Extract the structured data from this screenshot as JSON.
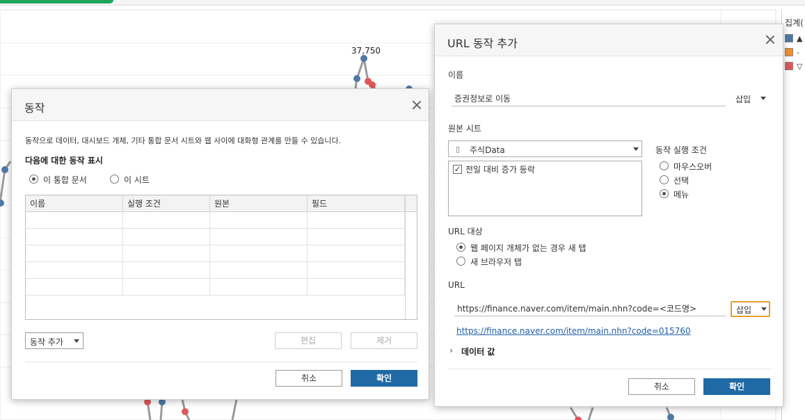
{
  "chart_data": {
    "type": "line",
    "title": "",
    "annotations": [
      "37,750"
    ],
    "series": []
  },
  "legend": {
    "title": "집계(",
    "items": [
      {
        "symbol": "▲",
        "color": "#4e79a7"
      },
      {
        "symbol": "-",
        "color": "#f28e2b"
      },
      {
        "symbol": "▽",
        "color": "#e15759"
      }
    ]
  },
  "actions_dialog": {
    "title": "동작",
    "description": "동작으로 데이터, 대시보드 개체, 기타 통합 문서 시트와 웹 사이에 대화형 관계를 만들 수 있습니다.",
    "show_actions_for": "다음에 대한 동작 표시",
    "scope_options": [
      {
        "label": "이 통합 문서",
        "selected": true
      },
      {
        "label": "이 시트",
        "selected": false
      }
    ],
    "table_columns": [
      "이름",
      "실행 조건",
      "원본",
      "필드"
    ],
    "add_action": "동작 추가",
    "edit": "편집",
    "remove": "제거",
    "cancel": "취소",
    "ok": "확인"
  },
  "url_dialog": {
    "title": "URL 동작 추가",
    "name_label": "이름",
    "name_value": "증권정보로 이동",
    "insert_label": "삽입",
    "source_sheet_label": "원본 시트",
    "source_value": "주식Data",
    "sheets": [
      {
        "label": "전일 대비 증가 등락",
        "checked": true
      }
    ],
    "run_on_label": "동작 실행 조건",
    "run_on_options": [
      {
        "label": "마우스오버",
        "selected": false
      },
      {
        "label": "선택",
        "selected": false
      },
      {
        "label": "메뉴",
        "selected": true
      }
    ],
    "url_target_label": "URL 대상",
    "url_target_options": [
      {
        "label": "웹 페이지 개체가 없는 경우 새 탭",
        "selected": true
      },
      {
        "label": "새 브라우저 탭",
        "selected": false
      }
    ],
    "url_label": "URL",
    "url_value": "https://finance.naver.com/item/main.nhn?code=<코드명>",
    "url_insert_label": "삽입",
    "url_preview": "https://finance.naver.com/item/main.nhn?code=015760",
    "data_values_label": "데이터 값",
    "cancel": "취소",
    "ok": "확인"
  }
}
